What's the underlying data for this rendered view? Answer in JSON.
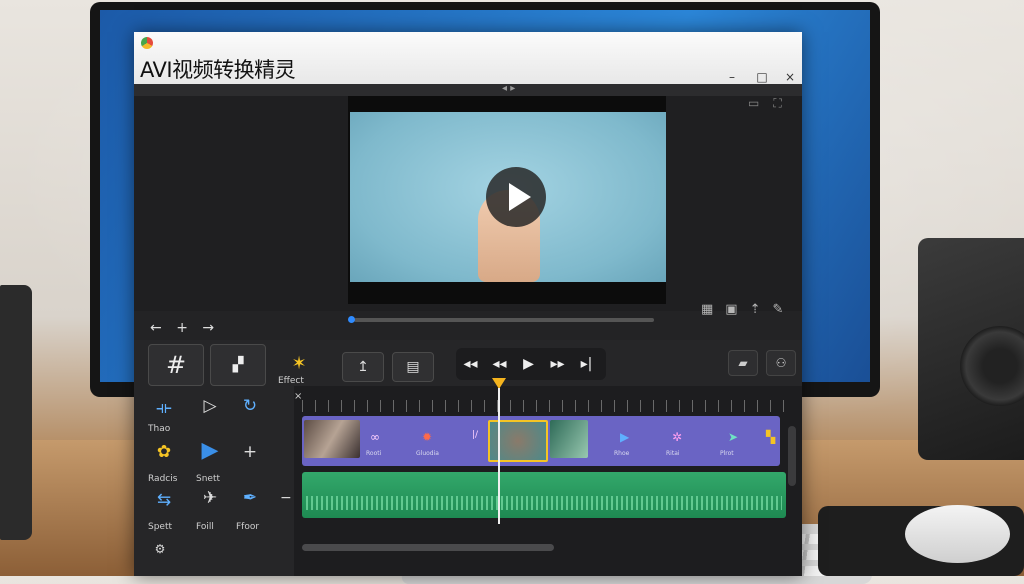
{
  "window": {
    "title": "AVI视频转换精灵",
    "minimize": "–",
    "maximize": "□",
    "close": "×",
    "nav_arrows": "◂ ▸"
  },
  "preview": {
    "play_icon": "play-icon",
    "progress": 0.02
  },
  "nav": {
    "back": "←",
    "add": "+",
    "forward": "→"
  },
  "toolbar": {
    "grid_icon": "#",
    "crop_label": "",
    "effects_label": "Effect",
    "import_icon": "↥",
    "transport": [
      "◂◂",
      "◂◂",
      "▶",
      "▸▸",
      "▸|"
    ]
  },
  "timeline": {
    "ruler_label": "A|",
    "left_panel": {
      "btn1_label": "Thao",
      "btn2_label": "Radcis",
      "btn3_label": "Snett",
      "btn4_label": "Spett",
      "btn5_label": "Foill",
      "btn6_label": "Ffoor"
    },
    "clip_labels": [
      "Rooti",
      "Gluodia",
      "Rhoe",
      "Ritai",
      "Plrot"
    ]
  },
  "colors": {
    "accent_blue": "#2f8bff",
    "playhead": "#f5b41e",
    "video_track": "#6a64c4",
    "audio_track": "#33a86b",
    "selected_clip_border": "#f5c424"
  }
}
